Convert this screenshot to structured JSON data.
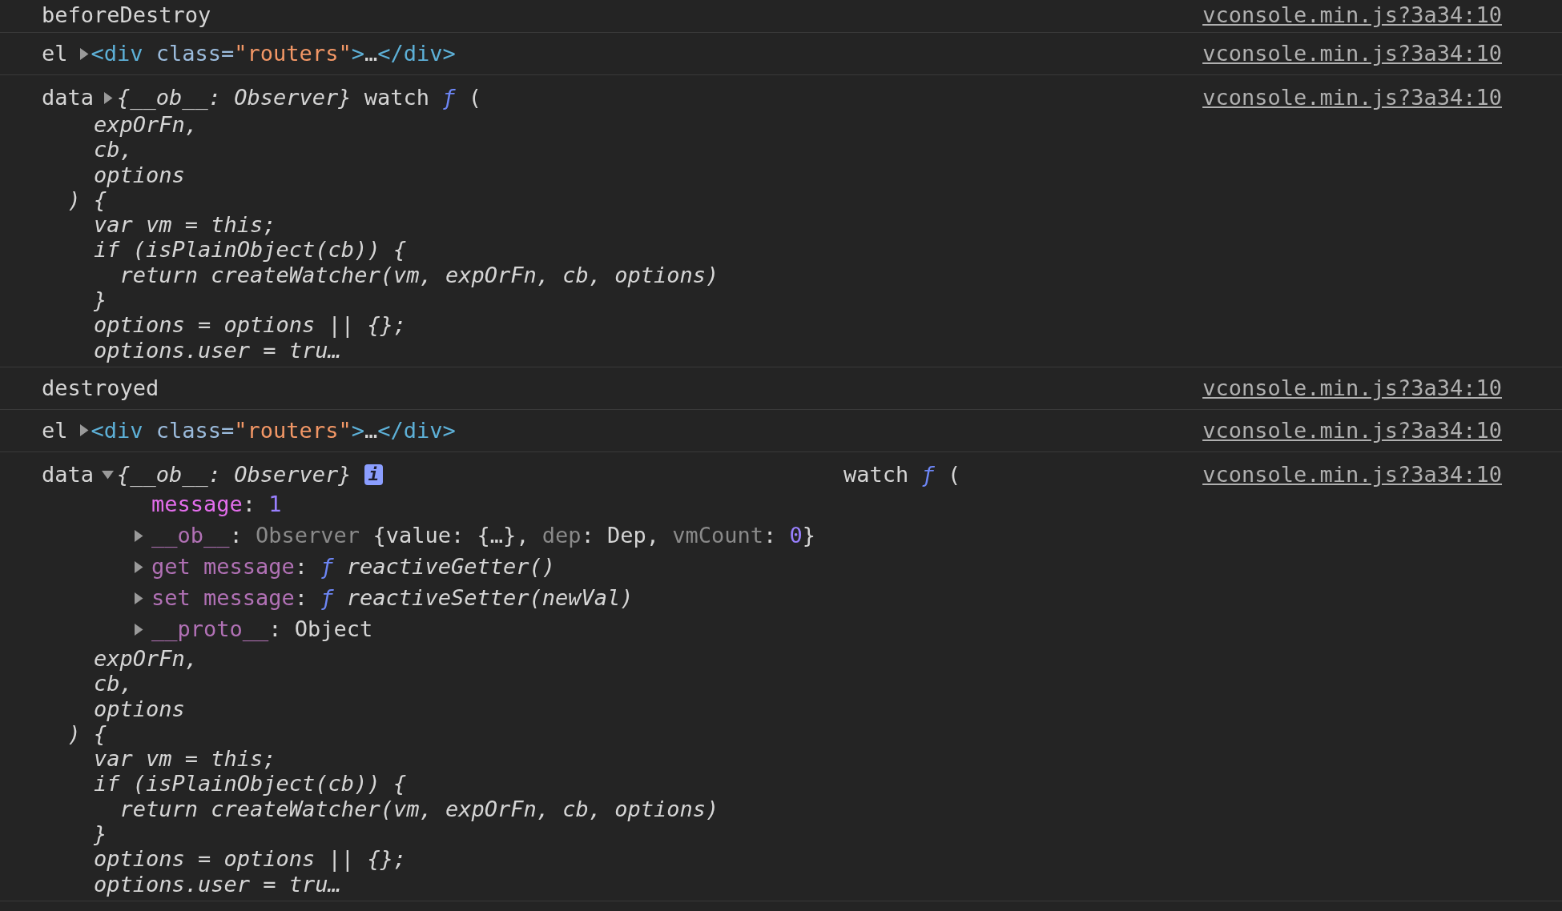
{
  "rows": [
    {
      "kind": "text",
      "text": "beforeDestroy",
      "source": "vconsole.min.js?3a34:10"
    },
    {
      "kind": "element",
      "label": "el",
      "expanded": false,
      "parts": [
        {
          "kind": "tag",
          "text": "<div"
        },
        {
          "kind": "attr",
          "text": " class="
        },
        {
          "kind": "string",
          "text": "\"routers\""
        },
        {
          "kind": "tag",
          "text": ">"
        },
        {
          "kind": "plain",
          "text": "…"
        },
        {
          "kind": "tag",
          "text": "</div>"
        }
      ],
      "source": "vconsole.min.js?3a34:10"
    },
    {
      "kind": "data",
      "label": "data",
      "expanded": false,
      "preview": "{__ob__: Observer}",
      "watch": "watch",
      "func_sign": "ƒ",
      "paren": "(",
      "code": "    expOrFn,\n    cb,\n    options\n  ) {\n    var vm = this;\n    if (isPlainObject(cb)) {\n      return createWatcher(vm, expOrFn, cb, options)\n    }\n    options = options || {};\n    options.user = tru…",
      "source": "vconsole.min.js?3a34:10"
    },
    {
      "kind": "text",
      "text": "destroyed",
      "source": "vconsole.min.js?3a34:10"
    },
    {
      "kind": "element",
      "label": "el",
      "expanded": false,
      "parts": [
        {
          "kind": "tag",
          "text": "<div"
        },
        {
          "kind": "attr",
          "text": " class="
        },
        {
          "kind": "string",
          "text": "\"routers\""
        },
        {
          "kind": "tag",
          "text": ">"
        },
        {
          "kind": "plain",
          "text": "…"
        },
        {
          "kind": "tag",
          "text": "</div>"
        }
      ],
      "source": "vconsole.min.js?3a34:10"
    },
    {
      "kind": "data",
      "label": "data",
      "expanded": true,
      "preview": "{__ob__: Observer}",
      "info_badge": "i",
      "watch": "watch",
      "func_sign": "ƒ",
      "paren": "(",
      "properties": [
        {
          "key": "message",
          "enumerable": true,
          "expandable": false,
          "value": [
            {
              "kind": "punct",
              "text": ": "
            },
            {
              "kind": "number",
              "text": "1"
            }
          ]
        },
        {
          "key": "__ob__",
          "enumerable": false,
          "expandable": true,
          "expanded": false,
          "value": [
            {
              "kind": "punct",
              "text": ": "
            },
            {
              "kind": "class",
              "text": "Observer "
            },
            {
              "kind": "punct",
              "text": "{value: {…}, "
            },
            {
              "kind": "dimkey",
              "text": "dep"
            },
            {
              "kind": "punct",
              "text": ": Dep, "
            },
            {
              "kind": "dimkey",
              "text": "vmCount"
            },
            {
              "kind": "punct",
              "text": ": "
            },
            {
              "kind": "number",
              "text": "0"
            },
            {
              "kind": "punct",
              "text": "}"
            }
          ]
        },
        {
          "key": "get message",
          "enumerable": false,
          "expandable": true,
          "expanded": false,
          "value": [
            {
              "kind": "punct",
              "text": ": "
            },
            {
              "kind": "func",
              "text": "ƒ "
            },
            {
              "kind": "italic",
              "text": "reactiveGetter()"
            }
          ]
        },
        {
          "key": "set message",
          "enumerable": false,
          "expandable": true,
          "expanded": false,
          "value": [
            {
              "kind": "punct",
              "text": ": "
            },
            {
              "kind": "func",
              "text": "ƒ "
            },
            {
              "kind": "italic",
              "text": "reactiveSetter(newVal)"
            }
          ]
        },
        {
          "key": "__proto__",
          "enumerable": false,
          "expandable": true,
          "expanded": false,
          "value": [
            {
              "kind": "punct",
              "text": ": Object"
            }
          ]
        }
      ],
      "code": "    expOrFn,\n    cb,\n    options\n  ) {\n    var vm = this;\n    if (isPlainObject(cb)) {\n      return createWatcher(vm, expOrFn, cb, options)\n    }\n    options = options || {};\n    options.user = tru…",
      "source": "vconsole.min.js?3a34:10"
    }
  ]
}
